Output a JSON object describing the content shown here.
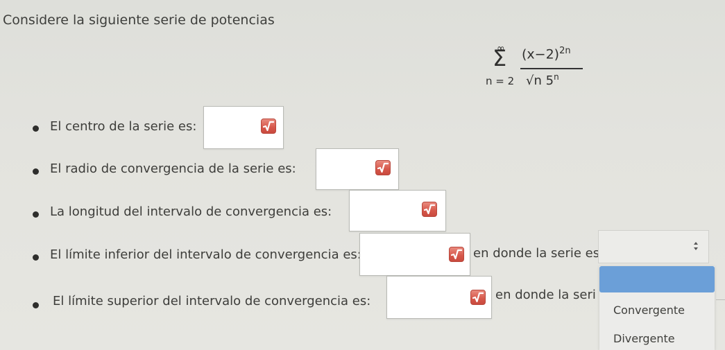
{
  "title": "Considere la siguiente serie de potencias",
  "formula": {
    "sum_upper": "∞",
    "sum_symbol": "Σ",
    "sum_lower": "n = 2",
    "numerator_base": "(x−2)",
    "numerator_exp": "2n",
    "denominator_root": "√n",
    "denominator_base": " 5",
    "denominator_exp": "n"
  },
  "questions": [
    {
      "text": "El centro de la serie es:"
    },
    {
      "text": "El radio de convergencia de la serie es:"
    },
    {
      "text": "La longitud del intervalo de convergencia es:"
    },
    {
      "text": "El límite inferior del intervalo de convergencia es:",
      "after_text": "en donde la serie es:"
    },
    {
      "text": "El límite superior del intervalo de convergencia es:",
      "after_text": "en donde la seri"
    }
  ],
  "dropdown": {
    "options": [
      "Convergente",
      "Divergente"
    ]
  },
  "icons": {
    "sqrt_button": "sqrt-icon",
    "select_arrows": "up-down-arrows-icon"
  },
  "colors": {
    "sqrt_button": "#d6574a",
    "highlight": "#6b9fd8"
  }
}
